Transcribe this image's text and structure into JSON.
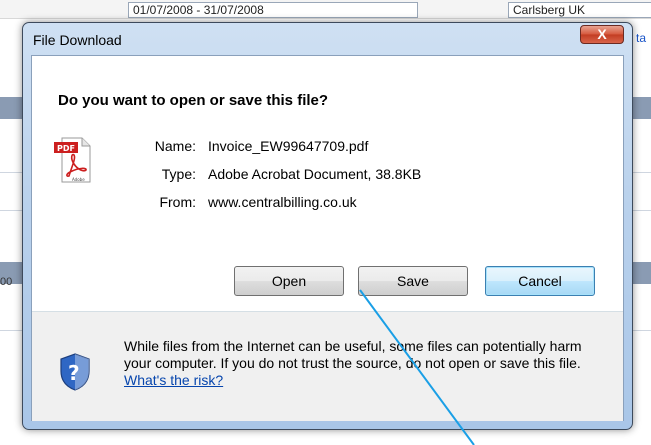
{
  "background": {
    "date_range": "01/07/2008 - 31/07/2008",
    "company": "Carlsberg UK",
    "edge_text_right": "ta",
    "edge_text_left": "00"
  },
  "dialog": {
    "title": "File Download",
    "close_label": "X",
    "question": "Do you want to open or save this file?",
    "file_icon": "pdf-file-icon",
    "name_label": "Name:",
    "name_value": "Invoice_EW99647709.pdf",
    "type_label": "Type:",
    "type_value": "Adobe Acrobat Document, 38.8KB",
    "from_label": "From:",
    "from_value": "www.centralbilling.co.uk",
    "buttons": {
      "open": "Open",
      "save": "Save",
      "cancel": "Cancel"
    },
    "warning_text": "While files from the Internet can be useful, some files can potentially harm your computer. If you do not trust the source, do not open or save this file.",
    "warning_link": "What's the risk?",
    "warning_icon": "security-shield-icon"
  },
  "annotation": {
    "color": "#1a9fe6"
  }
}
